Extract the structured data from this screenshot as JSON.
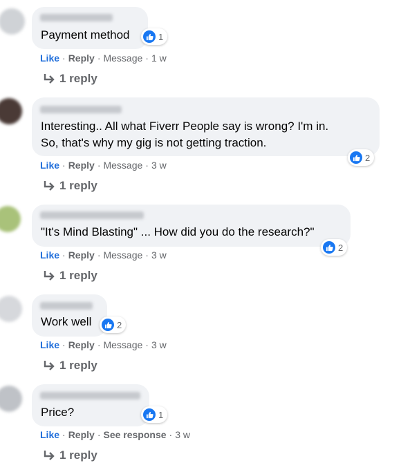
{
  "comments": [
    {
      "text": [
        "Payment method"
      ],
      "reactions": "1",
      "actions": {
        "like": "Like",
        "reply": "Reply",
        "extra": "Message",
        "time": "1 w"
      },
      "replies_label": "1 reply"
    },
    {
      "text": [
        "Interesting.. All what Fiverr People say is wrong? I'm in.",
        "So, that's why my gig is not getting traction."
      ],
      "reactions": "2",
      "actions": {
        "like": "Like",
        "reply": "Reply",
        "extra": "Message",
        "time": "3 w"
      },
      "replies_label": "1 reply"
    },
    {
      "text": [
        "\"It's Mind Blasting\" ... How did you do the research?\""
      ],
      "reactions": "2",
      "actions": {
        "like": "Like",
        "reply": "Reply",
        "extra": "Message",
        "time": "3 w"
      },
      "replies_label": "1 reply"
    },
    {
      "text": [
        "Work well"
      ],
      "reactions": "2",
      "actions": {
        "like": "Like",
        "reply": "Reply",
        "extra": "Message",
        "time": "3 w"
      },
      "replies_label": "1 reply"
    },
    {
      "text": [
        "Price?"
      ],
      "reactions": "1",
      "actions": {
        "like": "Like",
        "reply": "Reply",
        "extra": "See response",
        "time": "3 w"
      },
      "replies_label": "1 reply"
    }
  ],
  "colors": {
    "bubble": "#f0f2f5",
    "like_blue": "#1877f2",
    "link_blue": "#216fdb",
    "meta_gray": "#65676b"
  }
}
